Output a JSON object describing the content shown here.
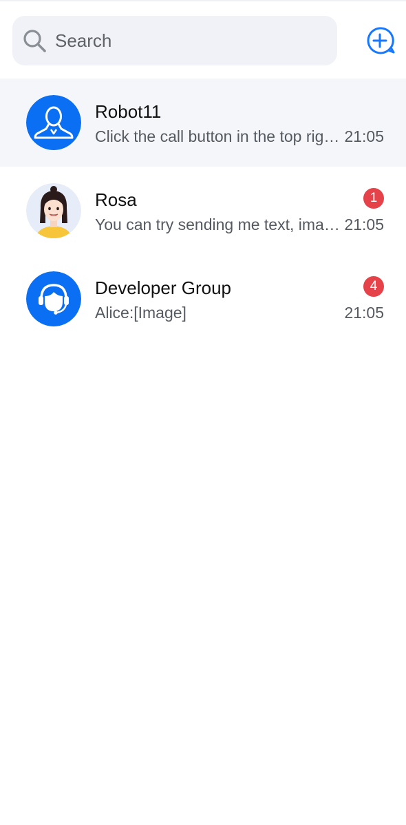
{
  "search": {
    "placeholder": "Search",
    "icon": "search-icon"
  },
  "header": {
    "add_icon": "add-chat-icon",
    "accent_color": "#1677ff"
  },
  "conversations": [
    {
      "name": "Robot11",
      "preview": "Click the call button in the top right corner to start a call",
      "time": "21:05",
      "unread": "",
      "avatar": "robot-avatar-icon",
      "selected": true
    },
    {
      "name": "Rosa",
      "preview": "You can try sending me text, images and emoji",
      "time": "21:05",
      "unread": "1",
      "avatar": "rosa-avatar",
      "selected": false
    },
    {
      "name": "Developer Group",
      "preview": "Alice:[Image]",
      "time": "21:05",
      "unread": "4",
      "avatar": "group-support-avatar-icon",
      "selected": false
    }
  ],
  "colors": {
    "badge": "#e5424a",
    "avatar_blue": "#0a6ff2",
    "selected_row": "#f5f6f9"
  }
}
